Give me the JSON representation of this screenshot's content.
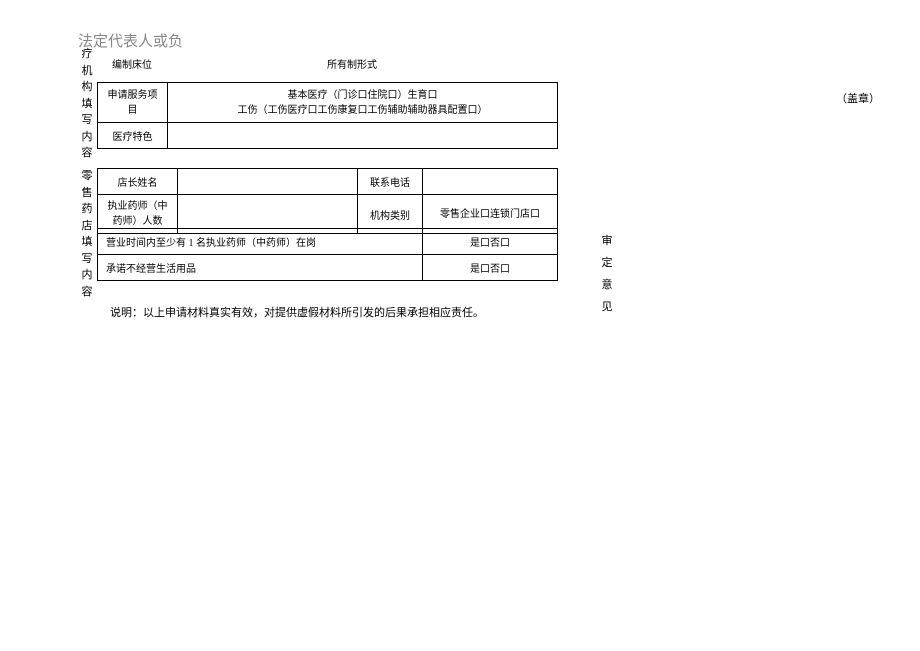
{
  "header": "法定代表人或负",
  "vlabel_med": "疗机构填写内容",
  "vlabel_pharm": "零售药店填写内容",
  "vlabel_opinion": "审定意见",
  "stamp": "（盖章）",
  "top_row": {
    "c1": "编制床位",
    "c2": "",
    "c3": "所有制形式",
    "c4": ""
  },
  "med_table": {
    "r1c1": "申请服务项目",
    "r1c2_line1": "基本医疗（门诊口住院口）生育口",
    "r1c2_line2": "工伤（工伤医疗口工伤康复口工伤辅助辅助器具配置口）",
    "r2c1": "医疗特色",
    "r2c2": ""
  },
  "pharm_table": {
    "r1c1": "店长姓名",
    "r1c2": "",
    "r1c3": "联系电话",
    "r1c4": "",
    "r2c1": "执业药师（中药师）人数",
    "r2c2": "",
    "r2c3": "机构类别",
    "r2c4": "零售企业口连锁门店口"
  },
  "pharm_table2": {
    "r1c1": "营业时间内至少有 1 名执业药师（中药师）在岗",
    "r1c2": "是口否口",
    "r2c1": "承诺不经营生活用品",
    "r2c2": "是口否口"
  },
  "explain": "说明：以上申请材料真实有效，对提供虚假材料所引发的后果承担相应责任。"
}
